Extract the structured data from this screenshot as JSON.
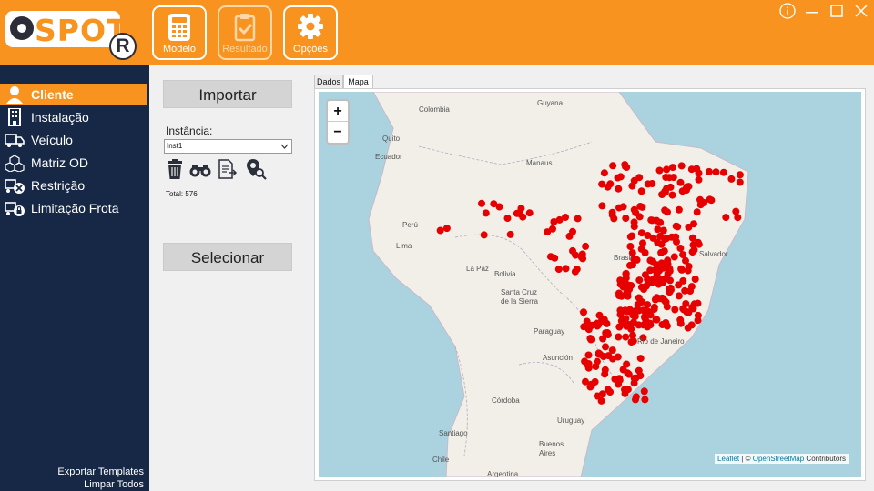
{
  "app": {
    "logo_text": "SPOT",
    "logo_badge": "R",
    "toolbar": [
      {
        "label": "Modelo",
        "icon": "calculator-icon",
        "enabled": true
      },
      {
        "label": "Resultado",
        "icon": "clipboard-check-icon",
        "enabled": false
      },
      {
        "label": "Opções",
        "icon": "gear-icon",
        "enabled": true
      }
    ]
  },
  "sidebar": {
    "items": [
      {
        "label": "Cliente",
        "icon": "user-icon",
        "active": true
      },
      {
        "label": "Instalação",
        "icon": "building-icon",
        "active": false
      },
      {
        "label": "Veículo",
        "icon": "truck-icon",
        "active": false
      },
      {
        "label": "Matriz OD",
        "icon": "cubes-icon",
        "active": false
      },
      {
        "label": "Restrição",
        "icon": "truck-restricted-icon",
        "active": false
      },
      {
        "label": "Limitação Frota",
        "icon": "truck-lock-icon",
        "active": false
      }
    ],
    "footer_links": [
      "Exportar Templates",
      "Limpar Todos"
    ]
  },
  "panel": {
    "import_label": "Importar",
    "instance_label": "Instância:",
    "instance_value": "Inst1",
    "total_text": "Total: 576",
    "select_label": "Selecionar",
    "actions": [
      "trash-icon",
      "binoculars-icon",
      "document-arrow-icon",
      "map-search-icon"
    ]
  },
  "tabs": [
    {
      "label": "Dados",
      "active": false
    },
    {
      "label": "Mapa",
      "active": true
    }
  ],
  "map": {
    "zoom_in": "+",
    "zoom_out": "−",
    "attribution_leaflet": "Leaflet",
    "attribution_sep": " | © ",
    "attribution_osm": "OpenStreetMap",
    "attribution_tail": " Contributors",
    "place_labels": [
      "Guyana",
      "Colombia",
      "Manaus",
      "Quito",
      "Ecuador",
      "Perú",
      "Lima",
      "La Paz",
      "Bolivia",
      "Santa Cruz de la Sierra",
      "Brasil",
      "Salvador",
      "Paraguay",
      "Asunción",
      "Rio de Janeiro",
      "Córdoba",
      "Uruguay",
      "Santiago",
      "Buenos Aires",
      "Chile",
      "Argentina"
    ],
    "marker_color": "#e60000"
  },
  "colors": {
    "accent": "#f7931e",
    "sidebar": "#162846",
    "water": "#aad3df",
    "land": "#f2efe9"
  }
}
